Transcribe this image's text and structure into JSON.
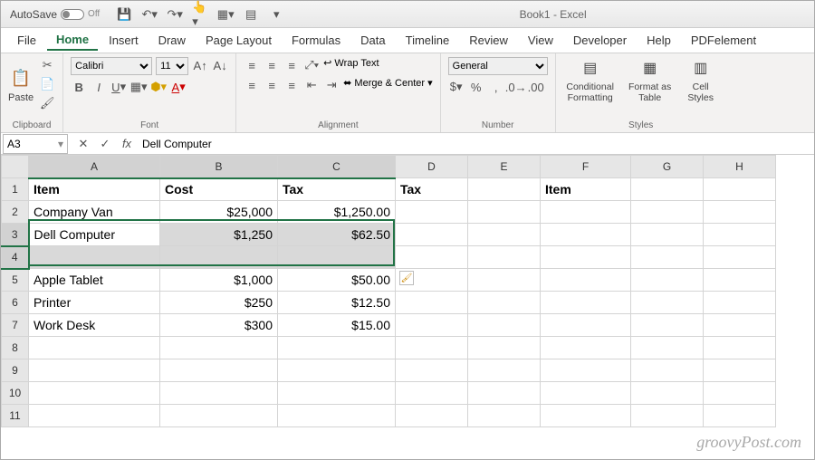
{
  "titlebar": {
    "autosave_label": "AutoSave",
    "autosave_state": "Off",
    "doc_title": "Book1 - Excel"
  },
  "menu": {
    "items": [
      "File",
      "Home",
      "Insert",
      "Draw",
      "Page Layout",
      "Formulas",
      "Data",
      "Timeline",
      "Review",
      "View",
      "Developer",
      "Help",
      "PDFelement"
    ],
    "active": "Home"
  },
  "ribbon": {
    "clipboard": {
      "paste": "Paste",
      "label": "Clipboard"
    },
    "font": {
      "name": "Calibri",
      "size": "11",
      "label": "Font"
    },
    "alignment": {
      "wrap": "Wrap Text",
      "merge": "Merge & Center",
      "label": "Alignment"
    },
    "number": {
      "format": "General",
      "label": "Number"
    },
    "styles": {
      "conditional": "Conditional Formatting",
      "formatas": "Format as Table",
      "cell": "Cell Styles",
      "label": "Styles"
    }
  },
  "namebox": {
    "ref": "A3",
    "formula_value": "Dell Computer"
  },
  "columns": [
    "A",
    "B",
    "C",
    "D",
    "E",
    "F",
    "G",
    "H"
  ],
  "rows": [
    "1",
    "2",
    "3",
    "4",
    "5",
    "6",
    "7",
    "8",
    "9",
    "10",
    "11"
  ],
  "cells": {
    "A1": "Item",
    "B1": "Cost",
    "C1": "Tax",
    "D1": "Tax",
    "F1": "Item",
    "A2": "Company Van",
    "B2": "$25,000",
    "C2": "$1,250.00",
    "A3": "Dell Computer",
    "B3": "$1,250",
    "C3": "$62.50",
    "A5": "Apple Tablet",
    "B5": "$1,000",
    "C5": "$50.00",
    "A6": "Printer",
    "B6": "$250",
    "C6": "$12.50",
    "A7": "Work Desk",
    "B7": "$300",
    "C7": "$15.00"
  },
  "selection": {
    "range": "A3:C4",
    "active": "A3"
  },
  "watermark": "groovyPost.com"
}
